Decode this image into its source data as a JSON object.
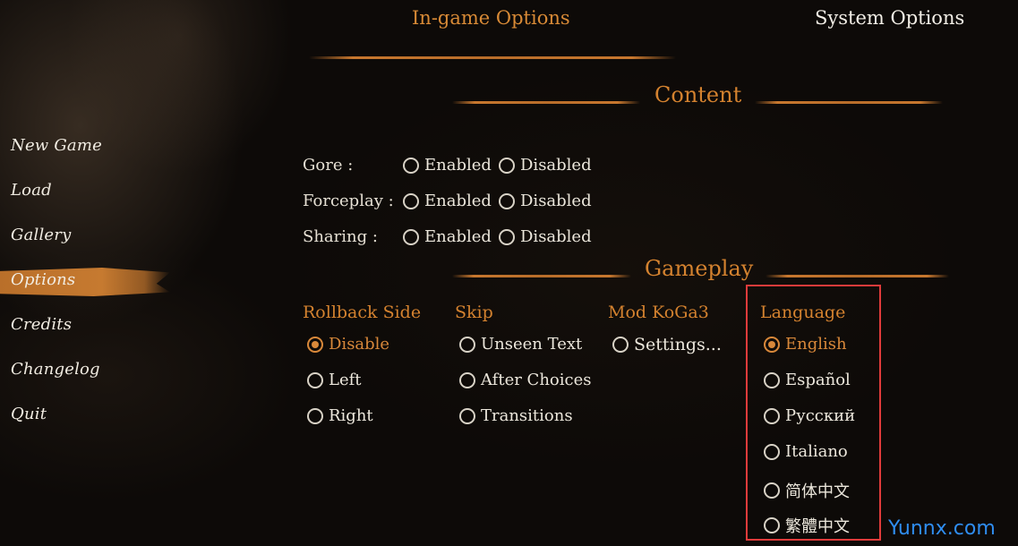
{
  "tabs": {
    "in_game": "In-game Options",
    "system": "System Options"
  },
  "menu": {
    "items": [
      "New Game",
      "Load",
      "Gallery",
      "Options",
      "Credits",
      "Changelog",
      "Quit"
    ],
    "selected": "Options"
  },
  "sections": {
    "content": "Content",
    "gameplay": "Gameplay"
  },
  "content_rows": [
    {
      "label": "Gore :",
      "enabled": "Enabled",
      "disabled": "Disabled"
    },
    {
      "label": "Forceplay :",
      "enabled": "Enabled",
      "disabled": "Disabled"
    },
    {
      "label": "Sharing :",
      "enabled": "Enabled",
      "disabled": "Disabled"
    }
  ],
  "gameplay": {
    "rollback": {
      "title": "Rollback Side",
      "options": [
        "Disable",
        "Left",
        "Right"
      ],
      "selected": "Disable"
    },
    "skip": {
      "title": "Skip",
      "options": [
        "Unseen Text",
        "After Choices",
        "Transitions"
      ]
    },
    "mod": {
      "title": "Mod KoGa3",
      "options": [
        "Settings..."
      ]
    },
    "language": {
      "title": "Language",
      "options": [
        "English",
        "Español",
        "Русский",
        "Italiano",
        "简体中文",
        "繁體中文"
      ],
      "selected": "English"
    }
  },
  "watermark": "Yunnx.com",
  "colors": {
    "accent": "#d4822f",
    "highlight_box": "#e03b3b",
    "watermark": "#2f8df0"
  }
}
